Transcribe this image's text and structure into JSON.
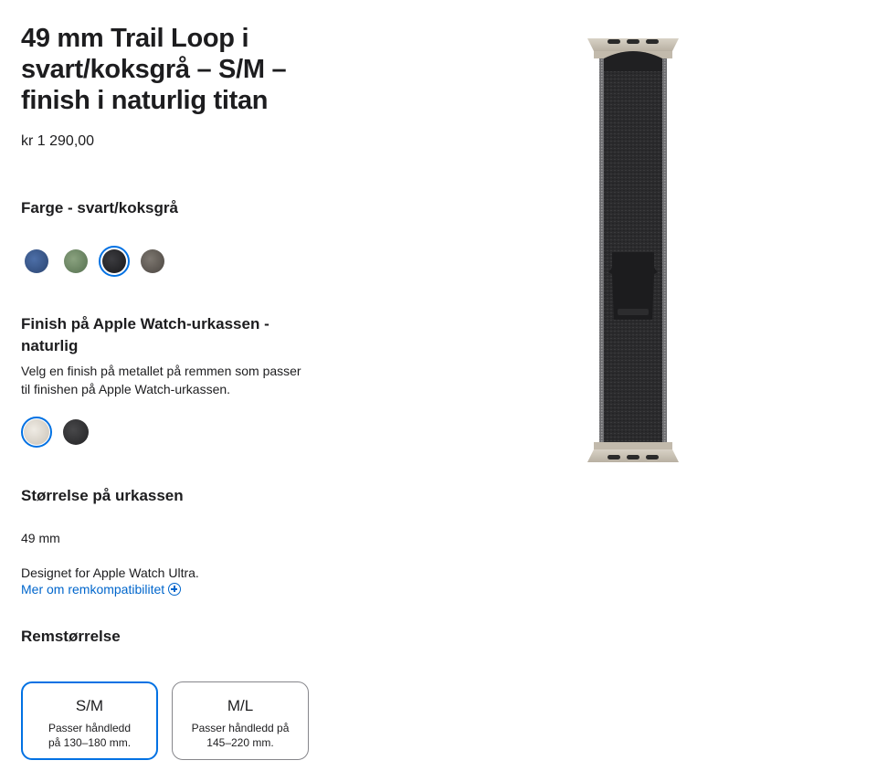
{
  "product": {
    "title": "49 mm Trail Loop i svart/koksgrå – S/M – finish i naturlig titan",
    "price": "kr 1 290,00"
  },
  "color": {
    "heading": "Farge - svart/koksgrå",
    "swatches": [
      {
        "name": "blue",
        "color": "#3a5a8f",
        "selected": false
      },
      {
        "name": "green",
        "color": "#6e8a66",
        "selected": false
      },
      {
        "name": "black",
        "color": "#2a2a2c",
        "selected": true
      },
      {
        "name": "grey",
        "color": "#6a6560",
        "selected": false
      }
    ]
  },
  "finish": {
    "heading": "Finish på Apple Watch-urkassen - naturlig",
    "description": "Velg en finish på metallet på remmen som passer til finishen på Apple Watch-urkassen.",
    "swatches": [
      {
        "name": "natural",
        "color": "#d9d3ca",
        "selected": true
      },
      {
        "name": "black",
        "color": "#333335",
        "selected": false
      }
    ]
  },
  "case_size": {
    "heading": "Størrelse på urkassen",
    "value": "49 mm",
    "compat_note": "Designet for Apple Watch Ultra.",
    "link": "Mer om remkompatibilitet"
  },
  "band_size": {
    "heading": "Remstørrelse",
    "options": [
      {
        "label": "S/M",
        "desc": "Passer håndledd på 130–180 mm.",
        "selected": true
      },
      {
        "label": "M/L",
        "desc": "Passer håndledd på 145–220 mm.",
        "selected": false
      }
    ]
  },
  "colors": {
    "accent": "#0071e3",
    "link": "#0066cc",
    "text": "#1d1d1f"
  }
}
